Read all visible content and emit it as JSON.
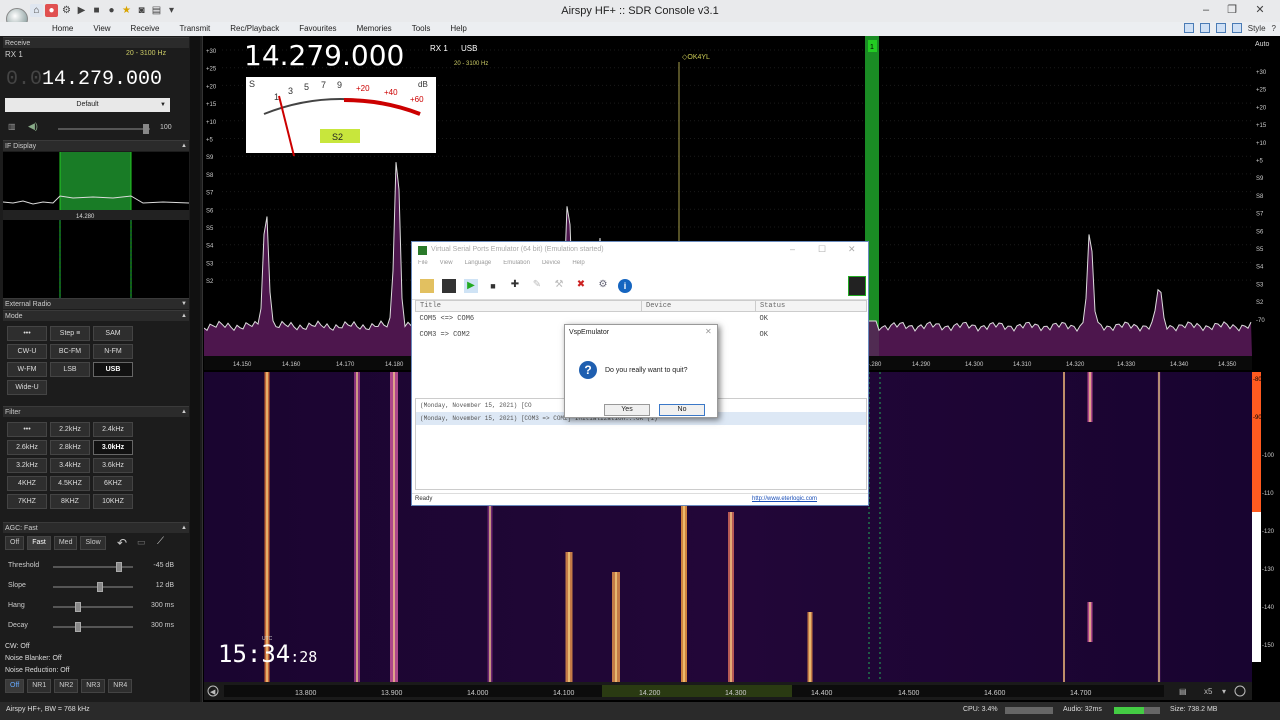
{
  "window": {
    "title": "Airspy HF+ :: SDR Console v3.1",
    "style_label": "Style"
  },
  "menu": [
    "Home",
    "View",
    "Receive",
    "Transmit",
    "Rec/Playback",
    "Favourites",
    "Memories",
    "Tools",
    "Help"
  ],
  "receive_panel": {
    "section_title": "Receive",
    "rx_label": "RX 1",
    "range": "20 - 3100 Hz",
    "freq_dim": "0.0",
    "freq": "14.279.000",
    "preset": "Default",
    "volume_value": "100",
    "if_display_title": "IF Display",
    "if_freq": "14.280",
    "external_radio_title": "External Radio",
    "mode_title": "Mode",
    "mode_buttons": [
      "•••",
      "Step ≡",
      "SAM",
      "CW-U",
      "BC-FM",
      "N-FM",
      "W-FM",
      "LSB",
      "USB",
      "Wide-U"
    ],
    "filter_title": "Filter",
    "filter_buttons": [
      "•••",
      "2.2kHz",
      "2.4kHz",
      "2.6kHz",
      "2.8kHz",
      "3.0kHz",
      "3.2kHz",
      "3.4kHz",
      "3.6kHz",
      "4KHZ",
      "4.5KHZ",
      "6KHZ",
      "7KHZ",
      "8KHZ",
      "10KHZ"
    ],
    "agc_title": "AGC: Fast",
    "agc_buttons": [
      "Off",
      "Fast",
      "Med",
      "Slow"
    ],
    "threshold_label": "Threshold",
    "threshold_value": "-45 dB",
    "threshold_level": 0.85,
    "slope_label": "Slope",
    "slope_value": "12 dB",
    "slope_level": 0.6,
    "hang_label": "Hang",
    "hang_value": "300 ms",
    "hang_level": 0.3,
    "decay_label": "Decay",
    "decay_value": "300 ms",
    "decay_level": 0.3,
    "cw_line": "CW: Off",
    "nb_line": "Noise Blanker: Off",
    "nr_line": "Noise Reduction: Off",
    "nr_buttons": [
      "Off",
      "NR1",
      "NR2",
      "NR3",
      "NR4"
    ]
  },
  "spectrum": {
    "freq": "14.279.000",
    "rx": "RX 1",
    "mode": "USB",
    "range": "20 - 3100 Hz",
    "marker_label": "◇OK4YL",
    "channel_badge": "1",
    "s_meter_value": "S2",
    "s_meter_scale": [
      "S",
      "1",
      "3",
      "5",
      "7",
      "9",
      "+20",
      "+40",
      "+60",
      "dB"
    ],
    "left_scale": [
      "+30",
      "+25",
      "+20",
      "+15",
      "+10",
      "+5",
      "S9",
      "S8",
      "S7",
      "S6",
      "S5",
      "S4",
      "S3",
      "S2"
    ],
    "right_scale": [
      "+30",
      "+25",
      "+20",
      "+15",
      "+10",
      "+5",
      "S9",
      "S8",
      "S7",
      "S6",
      "S5",
      "S4",
      "S3",
      "S2",
      "-70"
    ],
    "auto_label": "Auto",
    "freq_ticks": [
      "14.150",
      "14.160",
      "14.170",
      "14.180",
      "14.280",
      "14.290",
      "14.300",
      "14.310",
      "14.320",
      "14.330",
      "14.340",
      "14.350"
    ]
  },
  "waterfall": {
    "scale": [
      "-80",
      "-90",
      "-100",
      "-110",
      "-120",
      "-130",
      "-140",
      "-150"
    ],
    "clock_hm": "15:34",
    "clock_s": ":28",
    "clock_utc": "UTC",
    "freq_ticks": [
      "13.800",
      "13.900",
      "14.000",
      "14.100",
      "14.200",
      "14.300",
      "14.400",
      "14.500",
      "14.600",
      "14.700"
    ],
    "zoom": "x5"
  },
  "vsp": {
    "title": "Virtual Serial Ports Emulator (64 bit) (Emulation started)",
    "menu": [
      "File",
      "View",
      "Language",
      "Emulation",
      "Device",
      "Help"
    ],
    "columns": [
      "Title",
      "Device",
      "Status"
    ],
    "rows": [
      {
        "title": "COM5 <=> COM6",
        "device": "",
        "status": "OK"
      },
      {
        "title": "COM3 => COM2",
        "device": "",
        "status": "OK"
      }
    ],
    "log": [
      "(Monday, November 15, 2021) [CO",
      "(Monday, November 15, 2021) [COM3 => COM2] Initialization...OK (1)"
    ],
    "status": "Ready",
    "link": "http://www.eterlogic.com"
  },
  "quit_dialog": {
    "title": "VspEmulator",
    "message": "Do you really want to quit?",
    "yes": "Yes",
    "no": "No"
  },
  "statusbar": {
    "left": "Airspy HF+, BW = 768 kHz",
    "cpu": "CPU: 3.4%",
    "audio": "Audio: 32ms",
    "size": "Size: 738.2 MB"
  }
}
